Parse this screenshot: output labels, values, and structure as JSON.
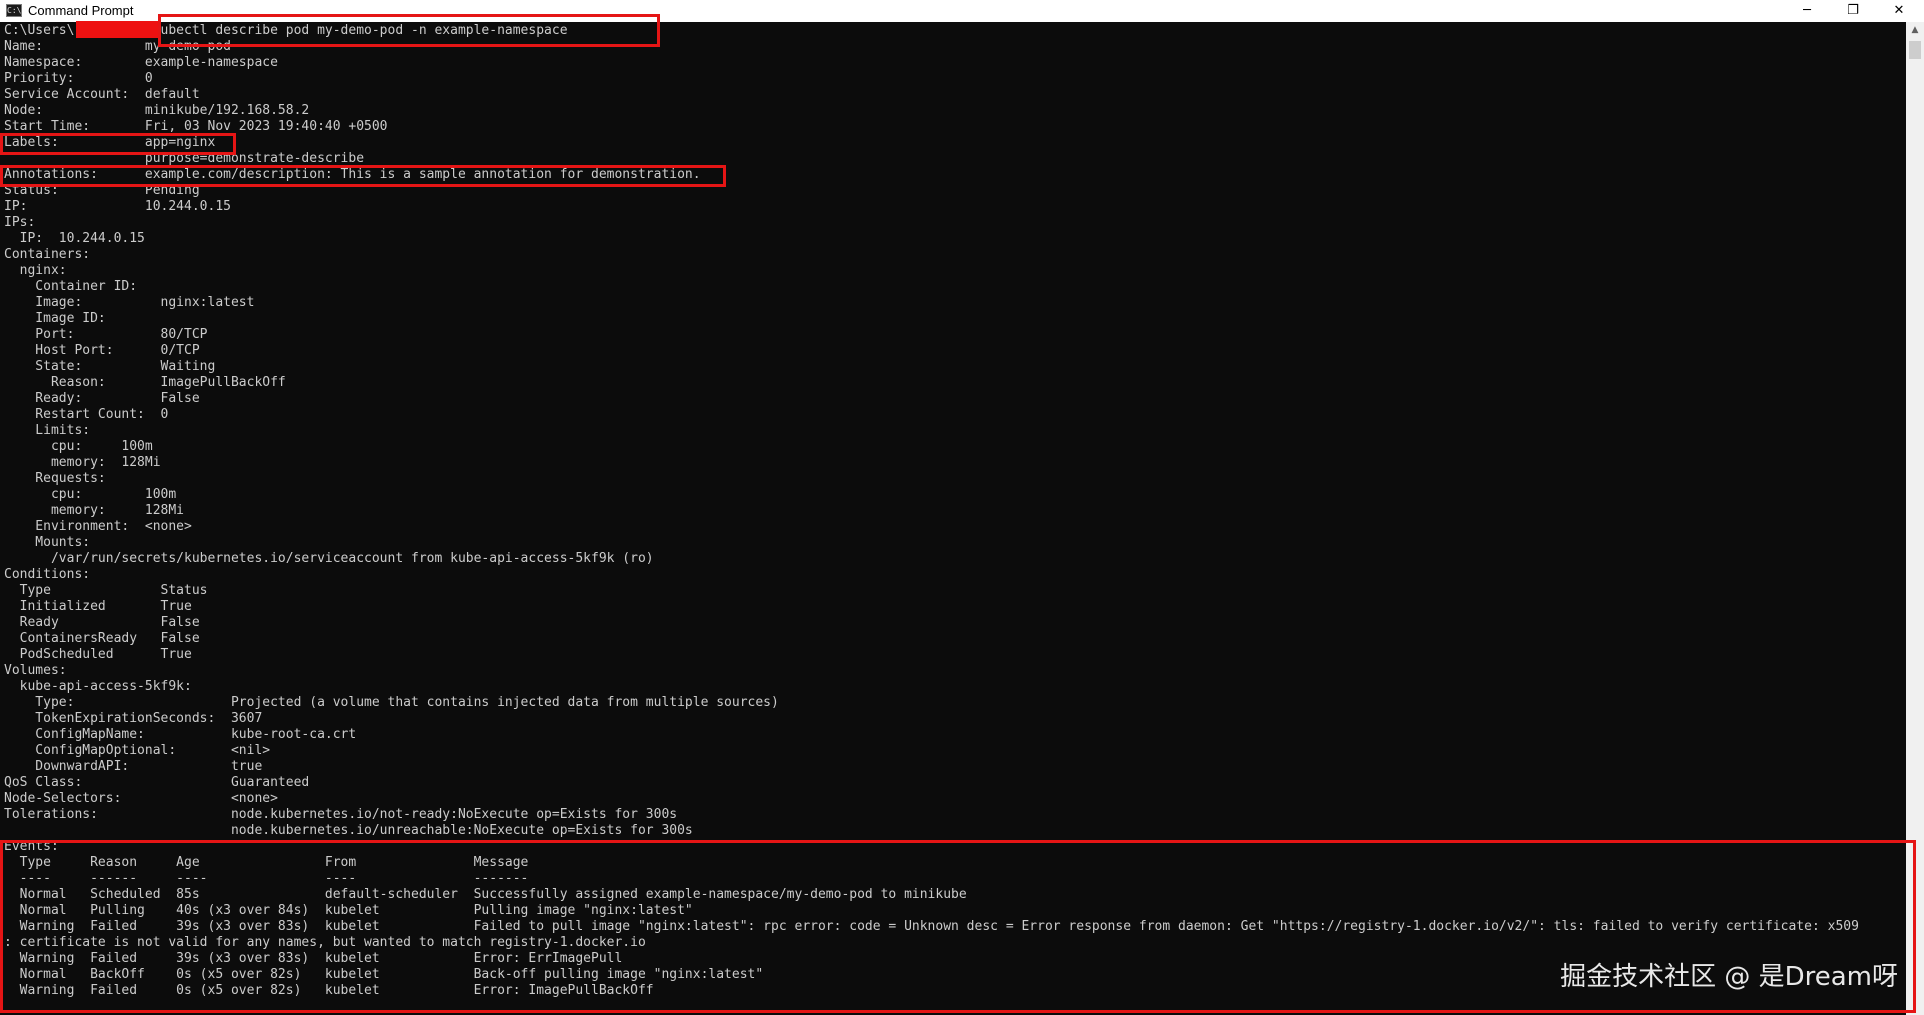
{
  "window": {
    "title": "Command Prompt",
    "icon": "console-icon",
    "icon_glyph": "C:\\",
    "controls": {
      "minimize": "─",
      "restore": "❐",
      "close": "✕"
    }
  },
  "console_lines": [
    "C:\\Users\\         >kubectl describe pod my-demo-pod -n example-namespace",
    "Name:             my-demo-pod",
    "Namespace:        example-namespace",
    "Priority:         0",
    "Service Account:  default",
    "Node:             minikube/192.168.58.2",
    "Start Time:       Fri, 03 Nov 2023 19:40:40 +0500",
    "Labels:           app=nginx",
    "                  purpose=demonstrate-describe",
    "Annotations:      example.com/description: This is a sample annotation for demonstration.",
    "Status:           Pending",
    "IP:               10.244.0.15",
    "IPs:",
    "  IP:  10.244.0.15",
    "Containers:",
    "  nginx:",
    "    Container ID:",
    "    Image:          nginx:latest",
    "    Image ID:",
    "    Port:           80/TCP",
    "    Host Port:      0/TCP",
    "    State:          Waiting",
    "      Reason:       ImagePullBackOff",
    "    Ready:          False",
    "    Restart Count:  0",
    "    Limits:",
    "      cpu:     100m",
    "      memory:  128Mi",
    "    Requests:",
    "      cpu:        100m",
    "      memory:     128Mi",
    "    Environment:  <none>",
    "    Mounts:",
    "      /var/run/secrets/kubernetes.io/serviceaccount from kube-api-access-5kf9k (ro)",
    "Conditions:",
    "  Type              Status",
    "  Initialized       True",
    "  Ready             False",
    "  ContainersReady   False",
    "  PodScheduled      True",
    "Volumes:",
    "  kube-api-access-5kf9k:",
    "    Type:                    Projected (a volume that contains injected data from multiple sources)",
    "    TokenExpirationSeconds:  3607",
    "    ConfigMapName:           kube-root-ca.crt",
    "    ConfigMapOptional:       <nil>",
    "    DownwardAPI:             true",
    "QoS Class:                   Guaranteed",
    "Node-Selectors:              <none>",
    "Tolerations:                 node.kubernetes.io/not-ready:NoExecute op=Exists for 300s",
    "                             node.kubernetes.io/unreachable:NoExecute op=Exists for 300s",
    "Events:",
    "  Type     Reason     Age                From               Message",
    "  ----     ------     ----               ----               -------",
    "  Normal   Scheduled  85s                default-scheduler  Successfully assigned example-namespace/my-demo-pod to minikube",
    "  Normal   Pulling    40s (x3 over 84s)  kubelet            Pulling image \"nginx:latest\"",
    "  Warning  Failed     39s (x3 over 83s)  kubelet            Failed to pull image \"nginx:latest\": rpc error: code = Unknown desc = Error response from daemon: Get \"https://registry-1.docker.io/v2/\": tls: failed to verify certificate: x509",
    ": certificate is not valid for any names, but wanted to match registry-1.docker.io",
    "  Warning  Failed     39s (x3 over 83s)  kubelet            Error: ErrImagePull",
    "  Normal   BackOff    0s (x5 over 82s)   kubelet            Back-off pulling image \"nginx:latest\"",
    "  Warning  Failed     0s (x5 over 82s)   kubelet            Error: ImagePullBackOff"
  ],
  "watermark": "掘金技术社区 @ 是Dream呀",
  "colors": {
    "background": "#0c0c0c",
    "text": "#cccccc",
    "highlight": "#e51515",
    "redaction": "#ee1111"
  }
}
